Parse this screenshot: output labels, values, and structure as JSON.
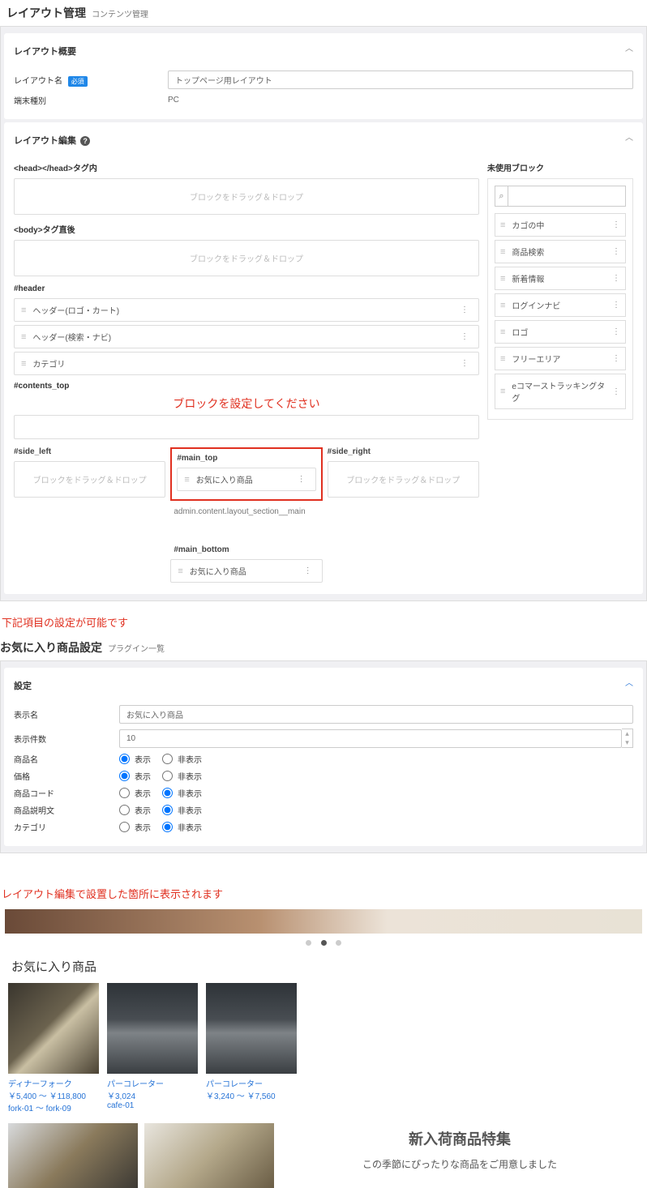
{
  "page1": {
    "title": "レイアウト管理",
    "breadcrumb": "コンテンツ管理",
    "summary": {
      "header": "レイアウト概要",
      "name_label": "レイアウト名",
      "required_badge": "必須",
      "name_value": "トップページ用レイアウト",
      "device_label": "端末種別",
      "device_value": "PC"
    },
    "edit": {
      "header": "レイアウト編集",
      "sec_head": "<head></head>タグ内",
      "drop_text": "ブロックをドラッグ＆ドロップ",
      "sec_body": "<body>タグ直後",
      "sec_header": "#header",
      "header_blocks": [
        "ヘッダー(ロゴ・カート)",
        "ヘッダー(検索・ナビ)",
        "カテゴリ"
      ],
      "sec_contents_top": "#contents_top",
      "red_instruction": "ブロックを設定してください",
      "side_left": "#side_left",
      "main_top": "#main_top",
      "main_top_block": "お気に入り商品",
      "side_right": "#side_right",
      "main_section_label": "admin.content.layout_section__main",
      "main_bottom": "#main_bottom",
      "main_bottom_block": "お気に入り商品",
      "unused": {
        "header": "未使用ブロック",
        "items": [
          "カゴの中",
          "商品検索",
          "新着情報",
          "ログインナビ",
          "ロゴ",
          "フリーエリア",
          "eコマーストラッキングタグ"
        ]
      }
    }
  },
  "note1": "下記項目の設定が可能です",
  "page2": {
    "title": "お気に入り商品設定",
    "breadcrumb": "プラグイン一覧",
    "settings_header": "設定",
    "rows": {
      "display_name": {
        "label": "表示名",
        "value": "お気に入り商品"
      },
      "display_count": {
        "label": "表示件数",
        "value": "10"
      },
      "product_name": {
        "label": "商品名",
        "show": true
      },
      "price": {
        "label": "価格",
        "show": true
      },
      "product_code": {
        "label": "商品コード",
        "show": false
      },
      "description": {
        "label": "商品説明文",
        "show": false
      },
      "category": {
        "label": "カテゴリ",
        "show": false
      }
    },
    "radio_show": "表示",
    "radio_hide": "非表示"
  },
  "note2": "レイアウト編集で設置した箇所に表示されます",
  "preview": {
    "fav_title": "お気に入り商品",
    "products": [
      {
        "name": "ディナーフォーク",
        "price": "￥5,400 ～ ￥118,800",
        "code": "fork-01 ～ fork-09"
      },
      {
        "name": "パーコレーター",
        "price": "￥3,024",
        "code": "cafe-01"
      },
      {
        "name": "パーコレーター",
        "price": "￥3,240 ～ ￥7,560",
        "code": ""
      }
    ],
    "feature_title": "新入荷商品特集",
    "feature_sub": "この季節にぴったりな商品をご用意しました"
  }
}
